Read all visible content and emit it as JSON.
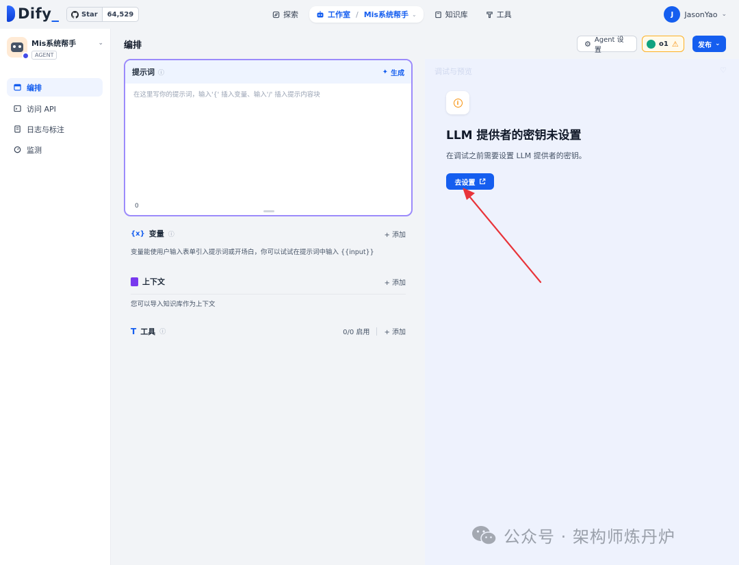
{
  "brand": {
    "name": "Dify",
    "underscore": "_"
  },
  "github": {
    "star_label": "Star",
    "count": "64,529"
  },
  "nav": {
    "explore": "探索",
    "studio": "工作室",
    "current_app": "Mis系统帮手",
    "knowledge": "知识库",
    "tools": "工具"
  },
  "user": {
    "initial": "J",
    "name": "JasonYao"
  },
  "app": {
    "name": "Mis系统帮手",
    "type": "AGENT"
  },
  "sidebar": {
    "items": [
      {
        "label": "编排"
      },
      {
        "label": "访问 API"
      },
      {
        "label": "日志与标注"
      },
      {
        "label": "监测"
      }
    ]
  },
  "main": {
    "title": "编排"
  },
  "header": {
    "agent_settings": "Agent 设置",
    "model_name": "o1",
    "publish": "发布"
  },
  "prompt": {
    "title": "提示词",
    "generate": "生成",
    "placeholder": "在这里写你的提示词，输入'{' 插入变量、输入'/' 插入提示内容块",
    "count": "0"
  },
  "variables": {
    "title": "变量",
    "add": "添加",
    "desc": "变量能使用户输入表单引入提示词或开场白，你可以试试在提示词中输入 {{input}}"
  },
  "context": {
    "title": "上下文",
    "add": "添加",
    "desc": "您可以导入知识库作为上下文"
  },
  "tools_section": {
    "title": "工具",
    "enabled": "0/0 启用",
    "add": "添加"
  },
  "debug": {
    "ghost_title": "调试与预览",
    "llm_title": "LLM 提供者的密钥未设置",
    "llm_desc": "在调试之前需要设置 LLM 提供者的密钥。",
    "go_settings": "去设置"
  },
  "watermark": {
    "text": "公众号 · 架构师炼丹炉"
  },
  "colors": {
    "accent": "#155eef",
    "warning": "#f79009",
    "arrow": "#e8343a"
  }
}
